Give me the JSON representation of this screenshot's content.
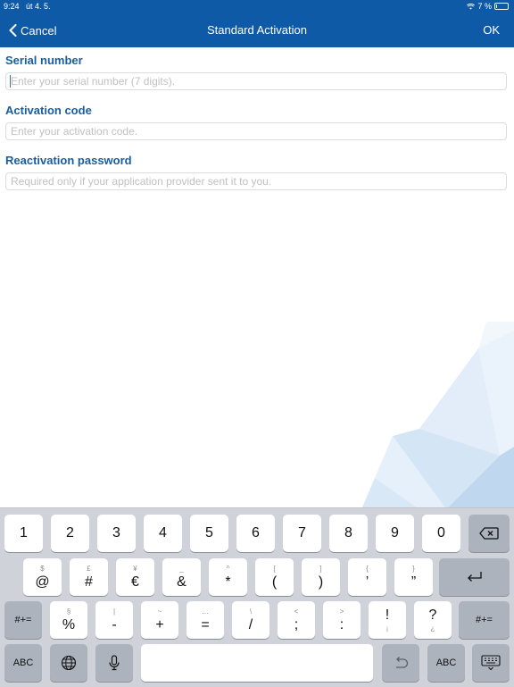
{
  "status_bar": {
    "time": "9:24",
    "date": "út 4. 5.",
    "battery": "7 %"
  },
  "nav": {
    "cancel_label": "Cancel",
    "title": "Standard Activation",
    "ok_label": "OK"
  },
  "form": {
    "serial": {
      "label": "Serial number",
      "placeholder": "Enter your serial number (7 digits)."
    },
    "activation": {
      "label": "Activation code",
      "placeholder": "Enter your activation code."
    },
    "reactivation": {
      "label": "Reactivation password",
      "placeholder": "Required only if your application provider sent it to you."
    }
  },
  "keyboard": {
    "row1": [
      "1",
      "2",
      "3",
      "4",
      "5",
      "6",
      "7",
      "8",
      "9",
      "0"
    ],
    "row2": [
      {
        "main": "@",
        "sub": "$"
      },
      {
        "main": "#",
        "sub": "£"
      },
      {
        "main": "€",
        "sub": "¥"
      },
      {
        "main": "&",
        "sub": "_"
      },
      {
        "main": "*",
        "sub": "^"
      },
      {
        "main": "(",
        "sub": "["
      },
      {
        "main": ")",
        "sub": "]"
      },
      {
        "main": "’",
        "sub": "{"
      },
      {
        "main": "”",
        "sub": "}"
      }
    ],
    "row3": [
      {
        "main": "%",
        "sub": "§"
      },
      {
        "main": "-",
        "sub": "|"
      },
      {
        "main": "+",
        "sub": "~"
      },
      {
        "main": "=",
        "sub": "…"
      },
      {
        "main": "/",
        "sub": "\\"
      },
      {
        "main": ";",
        "sub": "<"
      },
      {
        "main": ":",
        "sub": ">"
      },
      {
        "main": "!",
        "sub": "¡"
      },
      {
        "main": "?",
        "sub": "¿"
      }
    ],
    "shift_label": "#+=",
    "abc_label": "ABC"
  },
  "colors": {
    "nav_bg": "#0f5aa6",
    "label_blue": "#175e9f"
  }
}
